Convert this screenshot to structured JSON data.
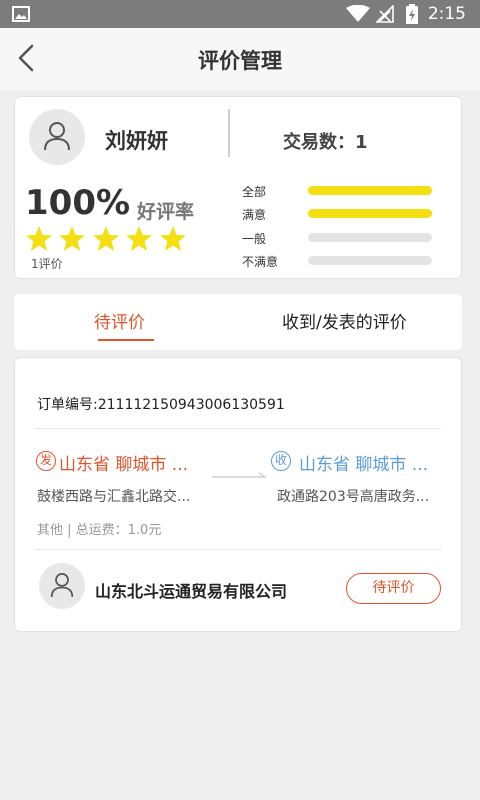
{
  "status_bar": {
    "time": "2:15"
  },
  "app_bar": {
    "title": "评价管理"
  },
  "profile": {
    "name": "刘妍妍",
    "trade_count_label": "交易数：1",
    "rate": "100%",
    "rate_label": "好评率",
    "review_count": "1评价",
    "stars": 5
  },
  "ratings": [
    {
      "label": "全部",
      "fill": 1.0
    },
    {
      "label": "满意",
      "fill": 1.0
    },
    {
      "label": "一般",
      "fill": 0.0
    },
    {
      "label": "不满意",
      "fill": 0.0
    }
  ],
  "tabs": [
    {
      "label": "待评价",
      "active": true
    },
    {
      "label": "收到/发表的评价",
      "active": false
    }
  ],
  "order": {
    "number_label": "订单编号:211112150943006130591",
    "from_badge": "发",
    "from_city": "山东省 聊城市 ...",
    "from_address": "鼓楼西路与汇鑫北路交...",
    "to_badge": "收",
    "to_city": "山东省 聊城市 ...",
    "to_address": "政通路203号高唐政务...",
    "fee_label": "其他 | 总运费：1.0元",
    "company": "山东北斗运通贸易有限公司",
    "action_label": "待评价"
  },
  "colors": {
    "accent": "#e2542b",
    "blue": "#5b9be0",
    "star": "#f4df12"
  }
}
